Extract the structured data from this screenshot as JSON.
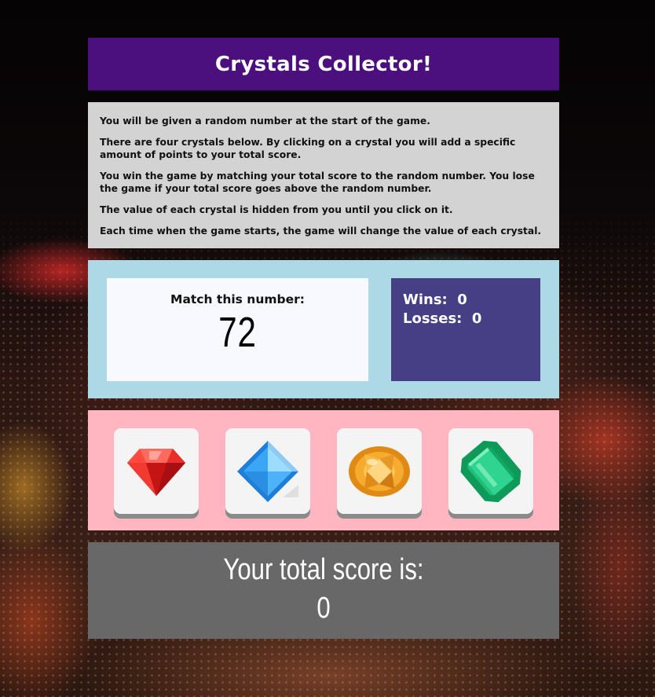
{
  "header": {
    "title": "Crystals Collector!"
  },
  "instructions": [
    "You will be given a random number at the start of the game.",
    "There are four crystals below. By clicking on a crystal you will add a specific amount of points to your total score.",
    "You win the game by matching your total score to the random number. You lose the game if your total score goes above the random number.",
    "The value of each crystal is hidden from you until you click on it.",
    "Each time when the game starts, the game will change the value of each crystal."
  ],
  "target": {
    "label": "Match this number:",
    "value": "72"
  },
  "record": {
    "wins_text": "Wins:  0",
    "losses_text": "Losses:  0"
  },
  "crystals": [
    {
      "icon": "red-ruby-icon",
      "color": "#e8322e"
    },
    {
      "icon": "blue-diamond-icon",
      "color": "#3fa7f0"
    },
    {
      "icon": "orange-topaz-icon",
      "color": "#f2a328"
    },
    {
      "icon": "green-emerald-icon",
      "color": "#1fbf7a"
    }
  ],
  "total": {
    "label": "Your total score is:",
    "value": "0"
  },
  "colors": {
    "title_bg": "#4b0f7e",
    "instructions_bg": "#d3d3d3",
    "scoreboard_bg": "#add8e6",
    "record_bg": "#463f86",
    "crystals_bg": "#ffb6c1",
    "total_bg": "#686868"
  }
}
